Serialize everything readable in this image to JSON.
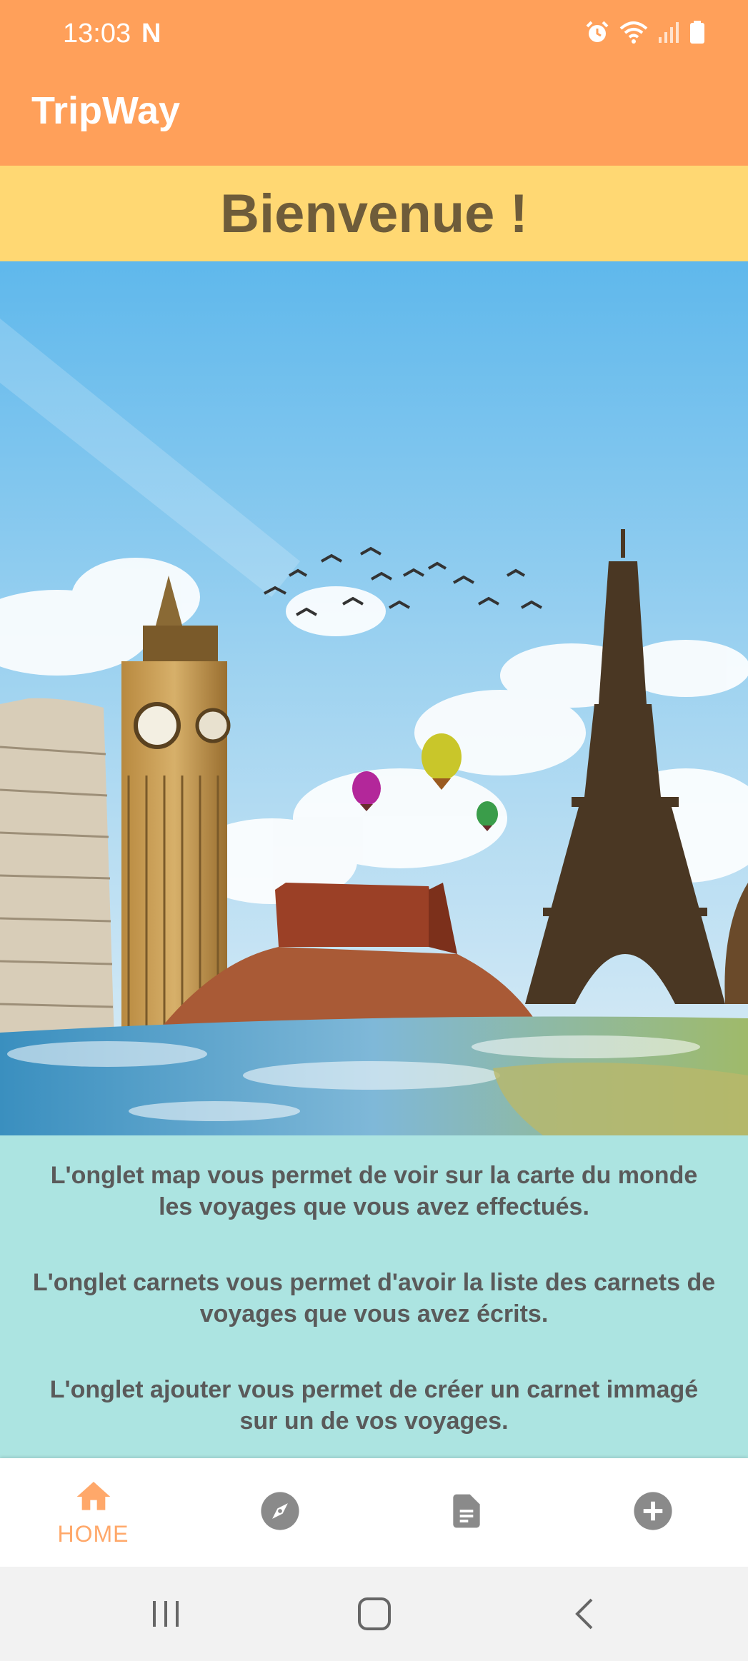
{
  "status_bar": {
    "time": "13:03",
    "notification": "N",
    "icons": [
      "alarm-icon",
      "wifi-icon",
      "signal-icon",
      "battery-icon"
    ]
  },
  "app_bar": {
    "title": "TripWay"
  },
  "welcome": {
    "text": "Bienvenue !"
  },
  "hero": {
    "image": "landmarks-illustration"
  },
  "info": {
    "paragraphs": [
      [
        "L'onglet map vous permet de voir sur la carte du monde",
        "les voyages que vous avez effectués."
      ],
      [
        "L'onglet carnets vous permet d'avoir la liste des carnets de",
        "voyages que vous avez écrits."
      ],
      [
        "L'onglet ajouter vous permet de créer un carnet immagé",
        "sur un de vos voyages."
      ]
    ]
  },
  "bottom_nav": {
    "items": [
      {
        "label": "HOME",
        "icon": "home-icon",
        "active": true
      },
      {
        "label": "",
        "icon": "compass-icon",
        "active": false
      },
      {
        "label": "",
        "icon": "notebook-icon",
        "active": false
      },
      {
        "label": "",
        "icon": "add-icon",
        "active": false
      }
    ]
  },
  "colors": {
    "primary": "#ffa05a",
    "welcome_bg": "#ffd873",
    "info_bg": "#ace4e1",
    "active_nav": "#ffa86a",
    "inactive_nav": "#8a8a8a"
  }
}
